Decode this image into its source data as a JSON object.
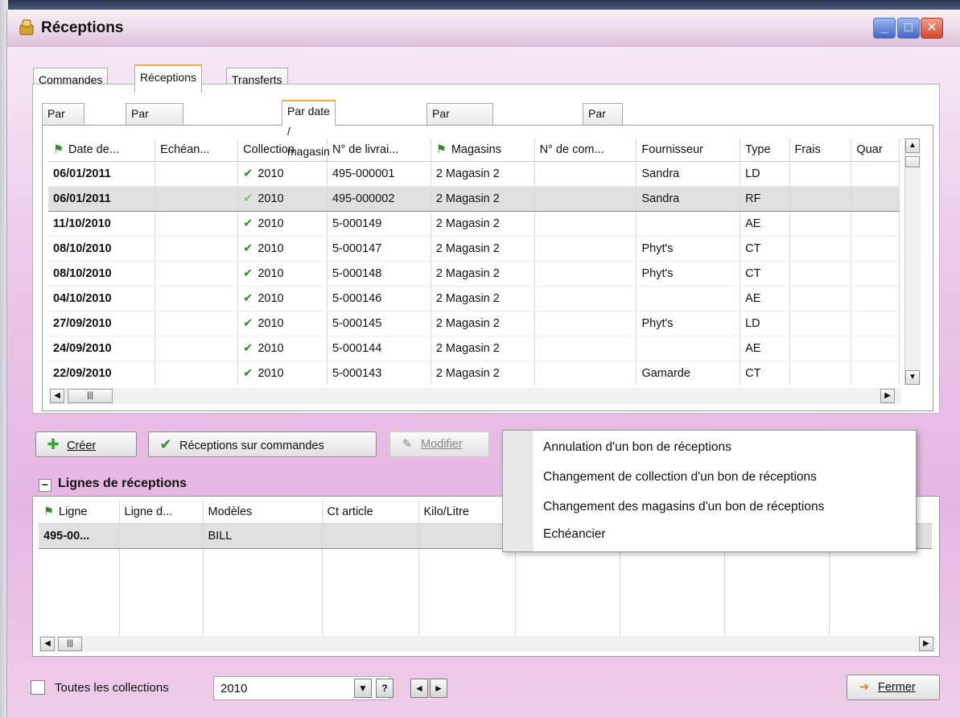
{
  "window": {
    "title": "Réceptions"
  },
  "main_tabs": [
    "Commandes",
    "Réceptions",
    "Transferts"
  ],
  "sub_tabs": [
    "Par défaut",
    "Par collection / n° BL",
    "Par date / magasin",
    "Par fournisseur / date",
    "Par libellé"
  ],
  "grid": {
    "columns": [
      "Date de...",
      "Echéan...",
      "Collection",
      "N° de livrai...",
      "Magasins",
      "N° de com...",
      "Fournisseur",
      "Type",
      "Frais",
      "Quar"
    ],
    "rows": [
      {
        "date": "06/01/2011",
        "ech": "",
        "coll": "2010",
        "livr": "495-000001",
        "mag": "2 Magasin 2",
        "com": "",
        "four": "Sandra",
        "type": "LD",
        "frais": "",
        "quar": ""
      },
      {
        "date": "06/01/2011",
        "ech": "",
        "coll": "2010",
        "livr": "495-000002",
        "mag": "2 Magasin 2",
        "com": "",
        "four": "Sandra",
        "type": "RF",
        "frais": "",
        "quar": ""
      },
      {
        "date": "11/10/2010",
        "ech": "",
        "coll": "2010",
        "livr": "5-000149",
        "mag": "2 Magasin 2",
        "com": "",
        "four": "",
        "type": "AE",
        "frais": "",
        "quar": ""
      },
      {
        "date": "08/10/2010",
        "ech": "",
        "coll": "2010",
        "livr": "5-000147",
        "mag": "2 Magasin 2",
        "com": "",
        "four": "Phyt's",
        "type": "CT",
        "frais": "",
        "quar": ""
      },
      {
        "date": "08/10/2010",
        "ech": "",
        "coll": "2010",
        "livr": "5-000148",
        "mag": "2 Magasin 2",
        "com": "",
        "four": "Phyt's",
        "type": "CT",
        "frais": "",
        "quar": ""
      },
      {
        "date": "04/10/2010",
        "ech": "",
        "coll": "2010",
        "livr": "5-000146",
        "mag": "2 Magasin 2",
        "com": "",
        "four": "",
        "type": "AE",
        "frais": "",
        "quar": ""
      },
      {
        "date": "27/09/2010",
        "ech": "",
        "coll": "2010",
        "livr": "5-000145",
        "mag": "2 Magasin 2",
        "com": "",
        "four": "Phyt's",
        "type": "LD",
        "frais": "",
        "quar": ""
      },
      {
        "date": "24/09/2010",
        "ech": "",
        "coll": "2010",
        "livr": "5-000144",
        "mag": "2 Magasin 2",
        "com": "",
        "four": "",
        "type": "AE",
        "frais": "",
        "quar": ""
      },
      {
        "date": "22/09/2010",
        "ech": "",
        "coll": "2010",
        "livr": "5-000143",
        "mag": "2 Magasin 2",
        "com": "",
        "four": "Gamarde",
        "type": "CT",
        "frais": "",
        "quar": ""
      }
    ]
  },
  "buttons": {
    "create": "Créer",
    "receptions_on_orders": "Réceptions sur commandes",
    "modify": "Modifier",
    "close": "Fermer"
  },
  "lines_section": {
    "title": "Lignes de réceptions",
    "columns": [
      "Ligne",
      "Ligne d...",
      "Modèles",
      "Ct article",
      "Kilo/Litre"
    ],
    "row": {
      "ligne": "495-00...",
      "ligne_d": "",
      "modeles": "BILL",
      "ct": "",
      "kilo": ""
    }
  },
  "context_menu": {
    "items": [
      "Annulation d'un bon de réceptions",
      "Changement de collection d'un bon de réceptions",
      "Changement des magasins d'un bon de réceptions",
      "Echéancier"
    ]
  },
  "bottom_bar": {
    "all_collections_label": "Toutes les collections",
    "collection_value": "2010",
    "help_label": "?"
  }
}
